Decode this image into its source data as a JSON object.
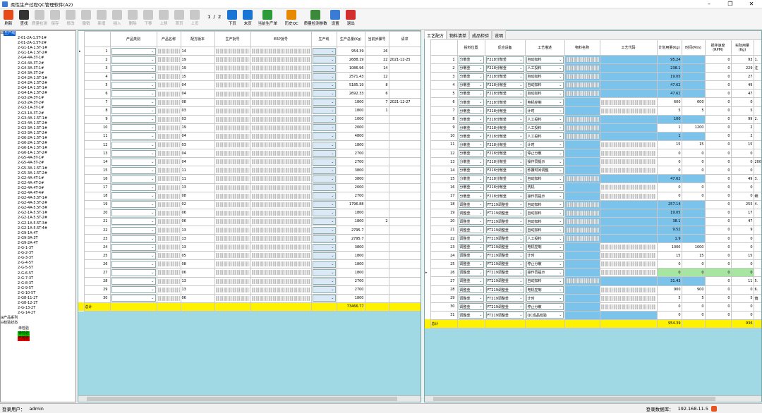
{
  "window": {
    "title": "柔性生产过程QC管理软件(A2)"
  },
  "toolbar": {
    "buttons": [
      {
        "label": "刷新",
        "icon": "refresh-icon",
        "color": "#e64a19",
        "enabled": true
      },
      {
        "label": "查找",
        "icon": "binoculars-icon",
        "color": "#333333",
        "enabled": true
      },
      {
        "label": "质量检测",
        "icon": "quality-check-icon",
        "enabled": false
      },
      {
        "label": "保存",
        "icon": "save-icon",
        "enabled": false
      },
      {
        "label": "修改",
        "icon": "edit-icon",
        "enabled": false
      },
      {
        "label": "撤销",
        "icon": "undo-icon",
        "enabled": false
      },
      {
        "label": "新增",
        "icon": "plus-icon",
        "enabled": false
      },
      {
        "label": "插入",
        "icon": "insert-icon",
        "enabled": false
      },
      {
        "label": "删除",
        "icon": "minus-icon",
        "enabled": false
      },
      {
        "label": "下移",
        "icon": "arrow-down-icon",
        "enabled": false
      },
      {
        "label": "上移",
        "icon": "arrow-up-icon",
        "enabled": false
      },
      {
        "label": "首页",
        "icon": "first-page-icon",
        "enabled": false
      },
      {
        "label": "上页",
        "icon": "prev-page-icon",
        "enabled": false
      }
    ],
    "pager": {
      "current": "1",
      "sep": "/",
      "total": "2"
    },
    "right_buttons": [
      {
        "label": "下页",
        "icon": "next-page-icon",
        "color": "#1a74d4"
      },
      {
        "label": "末页",
        "icon": "last-page-icon",
        "color": "#1a74d4"
      },
      {
        "label": "当前生产单",
        "icon": "production-order-icon",
        "color": "#2e9b3a"
      },
      {
        "label": "历史QC",
        "icon": "history-qc-icon",
        "color": "#e88a00"
      },
      {
        "label": "质量检测参数",
        "icon": "flask-icon",
        "color": "#3a8a3a"
      },
      {
        "label": "设置",
        "icon": "gear-icon",
        "color": "#3a7bd5"
      },
      {
        "label": "退出",
        "icon": "exit-icon",
        "color": "#d32f2f"
      }
    ]
  },
  "tree": {
    "root": "生产线",
    "items": [
      "2-01-2A-1.5T-1#",
      "2-01-2A-1.5T-2#",
      "2-G1-1A-1.5T-1#",
      "2-G1-1A-1.5T-2#",
      "2-G4-4A-3T-1#",
      "2-G4-4A-3T-2#",
      "2-G4-3A-3T-1#",
      "2-G4-3A-3T-2#",
      "2-G4-2A-1.5T-1#",
      "2-G4-2A-1.5T-2#",
      "2-G4-1A-1.5T-1#",
      "2-G4-1A-1.5T-2#",
      "2-G3-2A-3T-1#",
      "2-G3-2A-3T-2#",
      "2-G3-1A-3T-1#",
      "2-G3-1A-3T-2#",
      "2-G3-4A-1.5T-1#",
      "2-G3-4A-1.5T-2#",
      "2-G3-3A-1.5T-1#",
      "2-G3-3A-1.5T-2#",
      "2-G6-2A-1.5T-1#",
      "2-G6-2A-1.5T-2#",
      "2-G6-1A-1.5T-1#",
      "2-G6-1A-1.5T-2#",
      "2-G5-4A-5T-1#",
      "2-G5-4A-5T-2#",
      "2-G5-3A-1.5T-1#",
      "2-G5-3A-1.5T-2#",
      "2-G2-4A-4T-1#",
      "2-G2-4A-4T-2#",
      "2-G2-4A-4T-3#",
      "2-G2-4A-4T-4#",
      "2-G2-4A-5.5T-1#",
      "2-G2-4A-5.5T-2#",
      "2-G2-4A-5.5T-3#",
      "2-G2-1A-5.5T-1#",
      "2-G2-1A-5.5T-2#",
      "2-G2-1A-5.5T-3#",
      "2-G2-1A-5.5T-4#",
      "2-G9-1A-4T",
      "2-G9-3A-3T",
      "2-G9-2A-4T",
      "2-G-1-3T",
      "2-G-2-3T",
      "2-G-3-3T",
      "2-G-4-5T",
      "2-G-5-5T",
      "2-G-6-5T",
      "2-G-7-3T",
      "2-G-8-3T",
      "2-G-9-5T",
      "2-G-10-5T",
      "2-G8-11-2T",
      "2-G8-12-2T",
      "2-G-13-2T",
      "2-G-14-2T"
    ],
    "group2": "产品系列",
    "group3": "检验状态",
    "status": [
      {
        "label": "未检验",
        "color": "#ffffff"
      },
      {
        "label": "待检验",
        "color": "#00c800"
      },
      {
        "label": "已检验",
        "color": "#e00000"
      }
    ]
  },
  "left_grid": {
    "headers": [
      "产品类别",
      "产品名称",
      "配方版本",
      "生产批号",
      "ERP批号",
      "生产线",
      "生产总量(Kg)",
      "当前步骤号",
      "请求"
    ],
    "rows": [
      {
        "n": "1",
        "v": "14",
        "qty": "954.39",
        "step": "26",
        "req": ""
      },
      {
        "n": "2",
        "v": "19",
        "qty": "2688.19",
        "step": "22",
        "req": "2021-12-25"
      },
      {
        "n": "3",
        "v": "19",
        "qty": "1086.96",
        "step": "14",
        "req": ""
      },
      {
        "n": "4",
        "v": "15",
        "qty": "2571.43",
        "step": "12",
        "req": ""
      },
      {
        "n": "5",
        "v": "04",
        "qty": "5185.19",
        "step": "8",
        "req": ""
      },
      {
        "n": "6",
        "v": "04",
        "qty": "2692.33",
        "step": "6",
        "req": ""
      },
      {
        "n": "7",
        "v": "08",
        "qty": "1800",
        "step": "7",
        "req": "2021-12-27"
      },
      {
        "n": "8",
        "v": "03",
        "qty": "1800",
        "step": "1",
        "req": ""
      },
      {
        "n": "9",
        "v": "03",
        "qty": "1000",
        "step": "",
        "req": ""
      },
      {
        "n": "10",
        "v": "19",
        "qty": "2000",
        "step": "",
        "req": ""
      },
      {
        "n": "11",
        "v": "04",
        "qty": "4800",
        "step": "",
        "req": ""
      },
      {
        "n": "12",
        "v": "03",
        "qty": "1800",
        "step": "",
        "req": ""
      },
      {
        "n": "13",
        "v": "04",
        "qty": "2700",
        "step": "",
        "req": ""
      },
      {
        "n": "14",
        "v": "04",
        "qty": "2700",
        "step": "",
        "req": ""
      },
      {
        "n": "15",
        "v": "11",
        "qty": "3800",
        "step": "",
        "req": ""
      },
      {
        "n": "16",
        "v": "11",
        "qty": "3800",
        "step": "",
        "req": ""
      },
      {
        "n": "17",
        "v": "13",
        "qty": "2000",
        "step": "",
        "req": ""
      },
      {
        "n": "18",
        "v": "08",
        "qty": "2700",
        "step": "",
        "req": ""
      },
      {
        "n": "19",
        "v": "02",
        "qty": "1796.88",
        "step": "",
        "req": ""
      },
      {
        "n": "20",
        "v": "06",
        "qty": "1800",
        "step": "",
        "req": ""
      },
      {
        "n": "21",
        "v": "06",
        "qty": "1800",
        "step": "2",
        "req": ""
      },
      {
        "n": "22",
        "v": "13",
        "qty": "2795.7",
        "step": "",
        "req": ""
      },
      {
        "n": "23",
        "v": "13",
        "qty": "2795.7",
        "step": "",
        "req": ""
      },
      {
        "n": "24",
        "v": "13",
        "qty": "3800",
        "step": "",
        "req": ""
      },
      {
        "n": "25",
        "v": "05",
        "qty": "1800",
        "step": "",
        "req": ""
      },
      {
        "n": "26",
        "v": "08",
        "qty": "1800",
        "step": "",
        "req": ""
      },
      {
        "n": "27",
        "v": "06",
        "qty": "1800",
        "step": "",
        "req": ""
      },
      {
        "n": "28",
        "v": "13",
        "qty": "2700",
        "step": "",
        "req": ""
      },
      {
        "n": "29",
        "v": "13",
        "qty": "2700",
        "step": "",
        "req": ""
      },
      {
        "n": "30",
        "v": "06",
        "qty": "1800",
        "step": "",
        "req": ""
      }
    ],
    "total_label": "总计",
    "total_value": "73466.77"
  },
  "right_tabs": [
    "工艺配方",
    "物料清单",
    "成品检验",
    "说明"
  ],
  "right_grid": {
    "headers": [
      "投料位置",
      "反应设备",
      "工艺描述",
      "物料名称",
      "工艺代码",
      "计划用量(Kg)",
      "时间(Min)",
      "搅拌速度(RPM)",
      "实际用量(Kg)"
    ],
    "rows": [
      {
        "n": "1",
        "pos": "分散釜",
        "dev": "F218分散釜",
        "desc": "自动加料",
        "plan": "95.24",
        "time": "",
        "rpm": "0",
        "act": "93",
        "ex": "1."
      },
      {
        "n": "2",
        "pos": "分散釜",
        "dev": "F218分散釜",
        "desc": "人工投料",
        "plan": "238.1",
        "time": "",
        "rpm": "0",
        "act": "229",
        "ex": "注"
      },
      {
        "n": "3",
        "pos": "分散釜",
        "dev": "F218分散釜",
        "desc": "自动加料",
        "plan": "19.05",
        "time": "",
        "rpm": "0",
        "act": "27",
        "ex": ""
      },
      {
        "n": "4",
        "pos": "分散釜",
        "dev": "F218分散釜",
        "desc": "自动加料",
        "plan": "47.62",
        "time": "",
        "rpm": "0",
        "act": "49",
        "ex": ""
      },
      {
        "n": "5",
        "pos": "分散釜",
        "dev": "F218分散釜",
        "desc": "自动加料",
        "plan": "47.62",
        "time": "",
        "rpm": "0",
        "act": "47",
        "ex": ""
      },
      {
        "n": "6",
        "pos": "分散釜",
        "dev": "F218分散釜",
        "desc": "电机控制",
        "plan": "600",
        "time": "600",
        "rpm": "0",
        "act": "0",
        "ex": ""
      },
      {
        "n": "7",
        "pos": "分散釜",
        "dev": "F218分散釜",
        "desc": "计时",
        "plan": "5",
        "time": "5",
        "rpm": "0",
        "act": "5",
        "ex": ""
      },
      {
        "n": "8",
        "pos": "分散釜",
        "dev": "F218分散釜",
        "desc": "人工投料",
        "plan": "100",
        "time": "",
        "rpm": "0",
        "act": "99",
        "ex": "2."
      },
      {
        "n": "9",
        "pos": "分散釜",
        "dev": "F218分散釜",
        "desc": "人工投料",
        "plan": "1",
        "time": "1200",
        "rpm": "0",
        "act": "2",
        "ex": ""
      },
      {
        "n": "10",
        "pos": "分散釜",
        "dev": "F218分散釜",
        "desc": "人工投料",
        "plan": "1",
        "time": "",
        "rpm": "0",
        "act": "2",
        "ex": ""
      },
      {
        "n": "11",
        "pos": "分散釜",
        "dev": "F218分散釜",
        "desc": "计时",
        "plan": "15",
        "time": "15",
        "rpm": "0",
        "act": "15",
        "ex": ""
      },
      {
        "n": "12",
        "pos": "分散釜",
        "dev": "F218分散釜",
        "desc": "停止分散",
        "plan": "0",
        "time": "0",
        "rpm": "0",
        "act": "0",
        "ex": ""
      },
      {
        "n": "13",
        "pos": "分散釜",
        "dev": "F218分散釜",
        "desc": "操作员提示",
        "plan": "0",
        "time": "0",
        "rpm": "0",
        "act": "0",
        "ex": "200"
      },
      {
        "n": "14",
        "pos": "分散釜",
        "dev": "F218分散釜",
        "desc": "秒撒时间调整",
        "plan": "0",
        "time": "0",
        "rpm": "0",
        "act": "0",
        "ex": ""
      },
      {
        "n": "15",
        "pos": "分散釜",
        "dev": "F218分散釜",
        "desc": "自动加料",
        "plan": "47.62",
        "time": "",
        "rpm": "0",
        "act": "49",
        "ex": "3."
      },
      {
        "n": "16",
        "pos": "分散釜",
        "dev": "F218分散釜",
        "desc": "洗机",
        "plan": "0",
        "time": "0",
        "rpm": "0",
        "act": "0",
        "ex": ""
      },
      {
        "n": "17",
        "pos": "分散釜",
        "dev": "F218分散釜",
        "desc": "操作员提示",
        "plan": "0",
        "time": "0",
        "rpm": "0",
        "act": "0",
        "ex": "细"
      },
      {
        "n": "18",
        "pos": "调整釜",
        "dev": "FT219调整釜",
        "desc": "自动加料",
        "plan": "257.14",
        "time": "",
        "rpm": "0",
        "act": "255",
        "ex": "4."
      },
      {
        "n": "19",
        "pos": "调整釜",
        "dev": "FT219调整釜",
        "desc": "自动加料",
        "plan": "19.05",
        "time": "",
        "rpm": "0",
        "act": "17",
        "ex": ""
      },
      {
        "n": "20",
        "pos": "调整釜",
        "dev": "FT219调整釜",
        "desc": "自动加料",
        "plan": "38.1",
        "time": "",
        "rpm": "0",
        "act": "47",
        "ex": ""
      },
      {
        "n": "21",
        "pos": "调整釜",
        "dev": "FT219调整釜",
        "desc": "自动加料",
        "plan": "9.52",
        "time": "",
        "rpm": "0",
        "act": "9",
        "ex": ""
      },
      {
        "n": "22",
        "pos": "调整釜",
        "dev": "FT219调整釜",
        "desc": "人工投料",
        "plan": "1.9",
        "time": "",
        "rpm": "0",
        "act": "0",
        "ex": ""
      },
      {
        "n": "23",
        "pos": "调整釜",
        "dev": "FT219调整釜",
        "desc": "电机控制",
        "plan": "1000",
        "time": "1000",
        "rpm": "0",
        "act": "0",
        "ex": ""
      },
      {
        "n": "24",
        "pos": "调整釜",
        "dev": "FT219调整釜",
        "desc": "计时",
        "plan": "15",
        "time": "15",
        "rpm": "0",
        "act": "15",
        "ex": ""
      },
      {
        "n": "25",
        "pos": "调整釜",
        "dev": "FT219调整釜",
        "desc": "停止分散",
        "plan": "0",
        "time": "0",
        "rpm": "0",
        "act": "0",
        "ex": ""
      },
      {
        "n": "26",
        "pos": "调整釜",
        "dev": "FT219调整釜",
        "desc": "操作员提示",
        "plan": "0",
        "time": "0",
        "rpm": "0",
        "act": "0",
        "ex": ""
      },
      {
        "n": "27",
        "pos": "调整釜",
        "dev": "FT219调整釜",
        "desc": "自动加料",
        "plan": "31.43",
        "time": "",
        "rpm": "0",
        "act": "11",
        "ex": "5."
      },
      {
        "n": "28",
        "pos": "调整釜",
        "dev": "FT219调整釜",
        "desc": "电机控制",
        "plan": "900",
        "time": "900",
        "rpm": "0",
        "act": "0",
        "ex": "6."
      },
      {
        "n": "29",
        "pos": "调整釜",
        "dev": "FT219调整釜",
        "desc": "计时",
        "plan": "5",
        "time": "5",
        "rpm": "0",
        "act": "5",
        "ex": "偏"
      },
      {
        "n": "30",
        "pos": "调整釜",
        "dev": "FT219调整釜",
        "desc": "停止分散",
        "plan": "0",
        "time": "0",
        "rpm": "0",
        "act": "0",
        "ex": ""
      },
      {
        "n": "31",
        "pos": "调整釜",
        "dev": "FT219调整釜",
        "desc": "QC成品检验",
        "plan": "0",
        "time": "0",
        "rpm": "0",
        "act": "0",
        "ex": ""
      }
    ],
    "total_label": "总计",
    "total_plan": "954.39",
    "total_act": "936"
  },
  "status": {
    "user_label": "登录用户：",
    "user": "admin",
    "db_label": "登录数据库：",
    "db": "192.168.11.5"
  }
}
